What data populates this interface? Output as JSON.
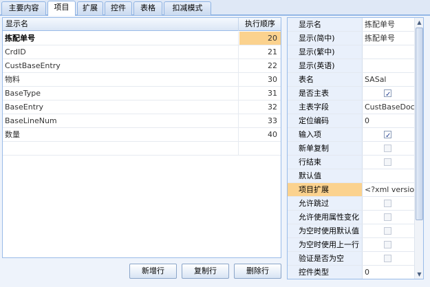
{
  "tabs": [
    "主要内容",
    "项目",
    "扩展",
    "控件",
    "表格",
    "扣减模式"
  ],
  "active_tab": 1,
  "grid": {
    "headers": [
      "显示名",
      "执行顺序"
    ],
    "rows": [
      {
        "name": "拣配单号",
        "order": "20"
      },
      {
        "name": "CrdID",
        "order": "21"
      },
      {
        "name": "CustBaseEntry",
        "order": "22"
      },
      {
        "name": "物料",
        "order": "30"
      },
      {
        "name": "BaseType",
        "order": "31"
      },
      {
        "name": "BaseEntry",
        "order": "32"
      },
      {
        "name": "BaseLineNum",
        "order": "33"
      },
      {
        "name": "数量",
        "order": "40"
      },
      {
        "name": "",
        "order": ""
      }
    ]
  },
  "buttons": {
    "add": "新增行",
    "copy": "复制行",
    "delete": "删除行"
  },
  "props": {
    "rows": [
      {
        "key": "显示名",
        "value": "拣配单号",
        "type": "text"
      },
      {
        "key": "显示(简中)",
        "value": "拣配单号",
        "type": "text"
      },
      {
        "key": "显示(繁中)",
        "value": "",
        "type": "text"
      },
      {
        "key": "显示(英语)",
        "value": "",
        "type": "text"
      },
      {
        "key": "表名",
        "value": "SASal",
        "type": "text"
      },
      {
        "key": "是否主表",
        "value": "checked",
        "type": "check"
      },
      {
        "key": "主表字段",
        "value": "CustBaseDocN",
        "type": "text"
      },
      {
        "key": "定位编码",
        "value": "0",
        "type": "text"
      },
      {
        "key": "输入项",
        "value": "checked",
        "type": "check"
      },
      {
        "key": "新单复制",
        "value": "disabled",
        "type": "check"
      },
      {
        "key": "行结束",
        "value": "disabled",
        "type": "check"
      },
      {
        "key": "默认值",
        "value": "",
        "type": "text"
      },
      {
        "key": "项目扩展",
        "value": "<?xml version",
        "type": "text",
        "highlight": true
      },
      {
        "key": "允许跳过",
        "value": "disabled",
        "type": "check"
      },
      {
        "key": "允许使用属性变化",
        "value": "disabled",
        "type": "check"
      },
      {
        "key": "为空时使用默认值",
        "value": "disabled",
        "type": "check"
      },
      {
        "key": "为空时使用上一行",
        "value": "disabled",
        "type": "check"
      },
      {
        "key": "验证是否为空",
        "value": "disabled",
        "type": "check"
      },
      {
        "key": "控件类型",
        "value": "0",
        "type": "text"
      }
    ]
  }
}
